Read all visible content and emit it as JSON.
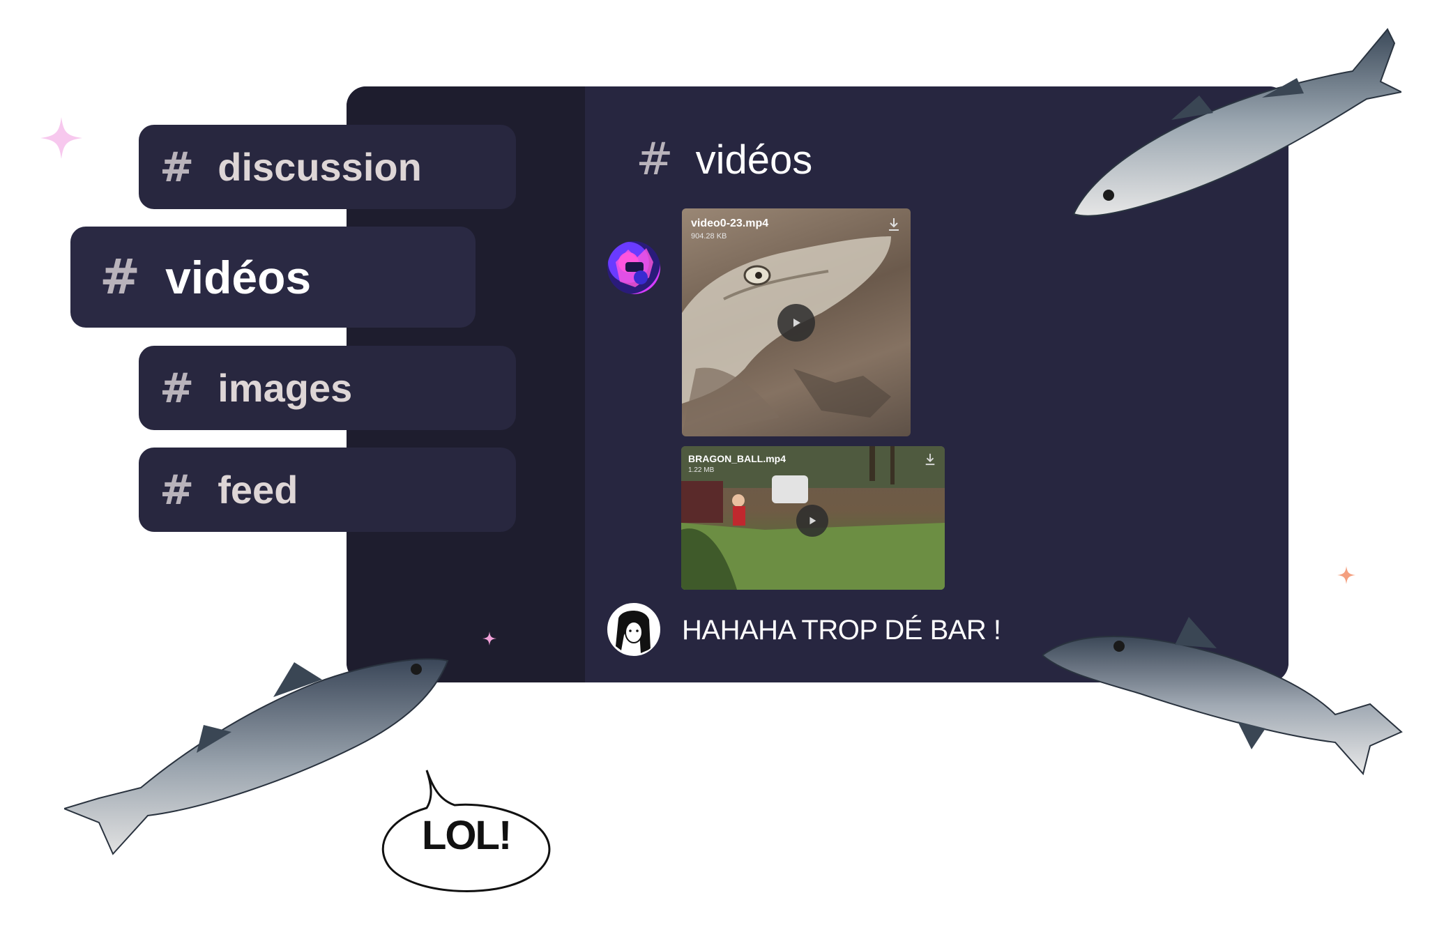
{
  "channels": [
    {
      "hash": "#",
      "label": "discussion"
    },
    {
      "hash": "#",
      "label": "vidéos"
    },
    {
      "hash": "#",
      "label": "images"
    },
    {
      "hash": "#",
      "label": "feed"
    }
  ],
  "chat": {
    "hash": "#",
    "title": "vidéos",
    "attachments": [
      {
        "filename": "video0-23.mp4",
        "size": "904.28 KB"
      },
      {
        "filename": "BRAGON_BALL.mp4",
        "size": "1.22 MB"
      }
    ],
    "message": "HAHAHA TROP DÉ BAR !"
  },
  "bubble": {
    "text": "LOL!"
  },
  "colors": {
    "window_bg": "#272640",
    "sidebar_bg": "#1e1d2e",
    "chip_bg": "#28273f",
    "sparkle_pink": "#f7c8ee",
    "sparkle_orange": "#f4a080"
  },
  "icons": [
    "hash-icon",
    "download-icon",
    "play-icon",
    "sparkle-icon",
    "fish-decoration"
  ]
}
